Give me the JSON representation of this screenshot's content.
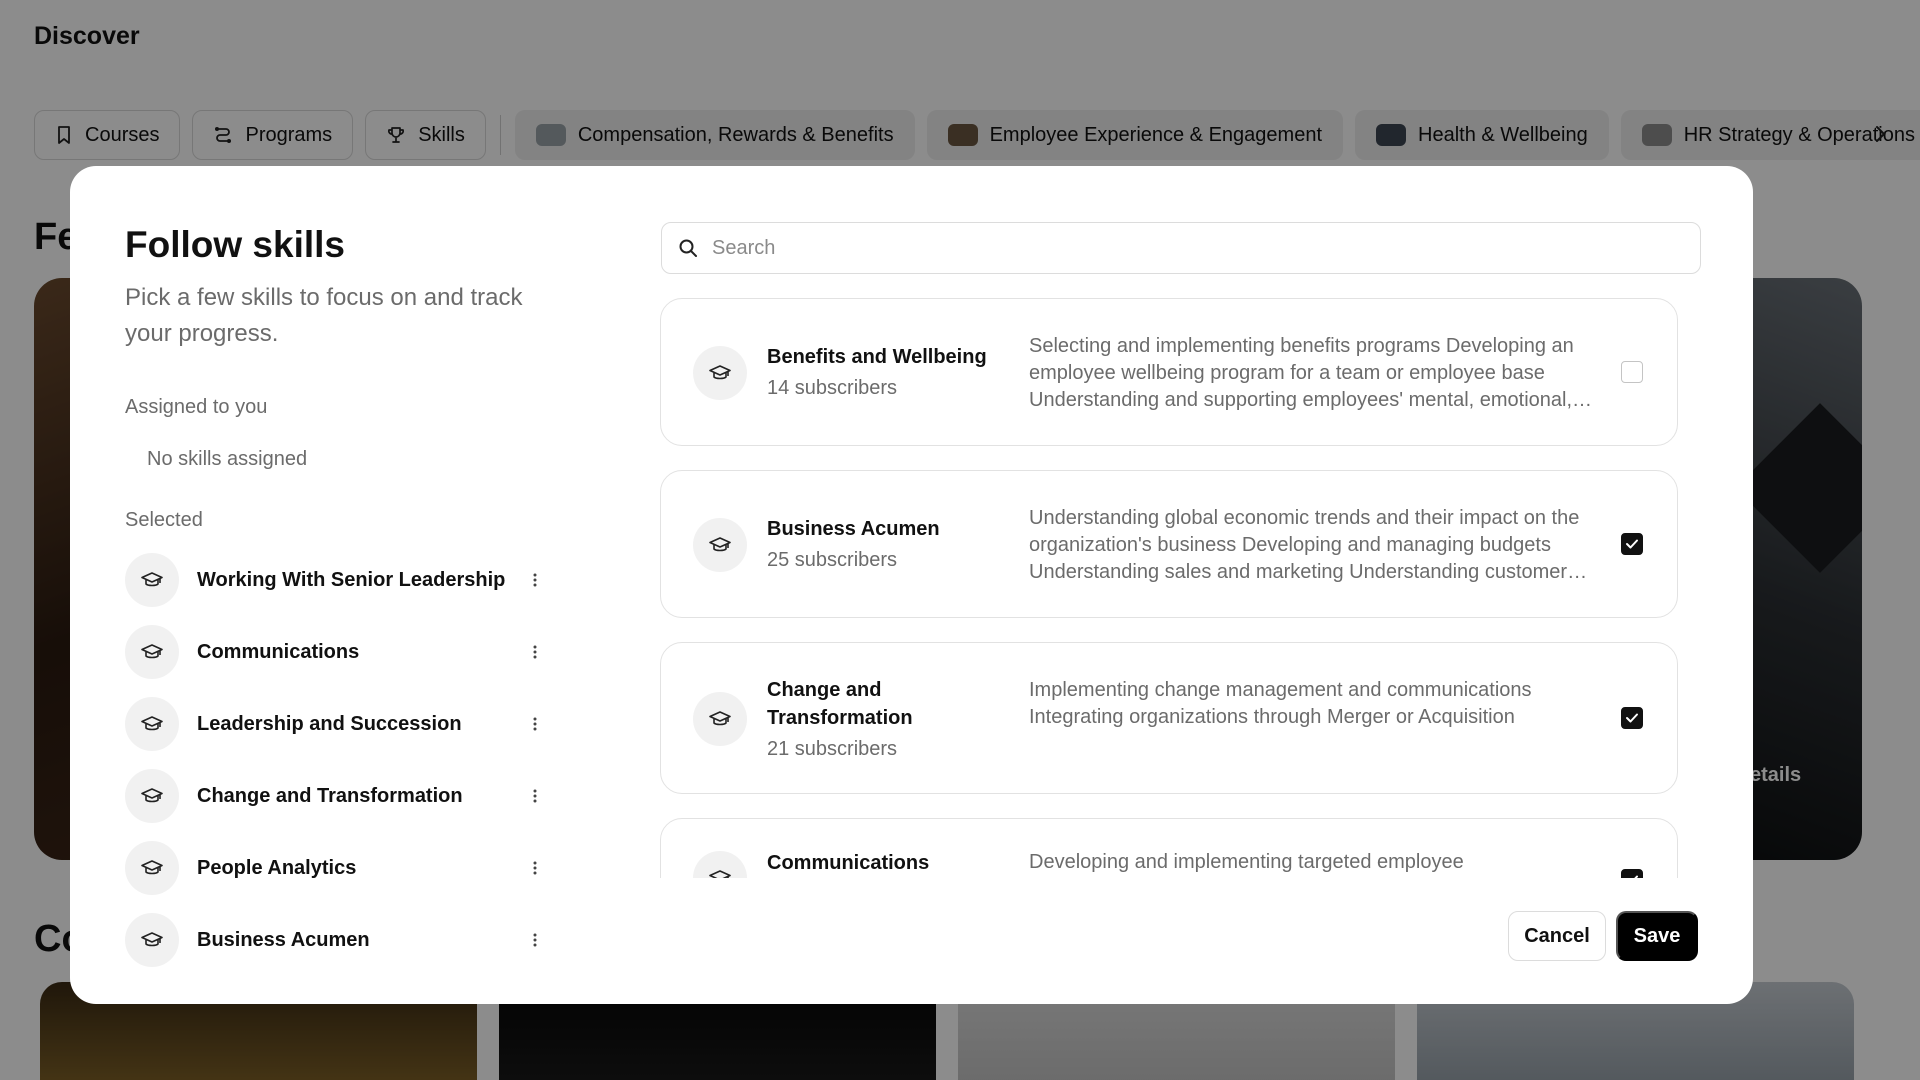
{
  "page": {
    "title": "Discover",
    "tabs": [
      {
        "label": "Courses",
        "icon": "bookmark-icon"
      },
      {
        "label": "Programs",
        "icon": "route-icon"
      },
      {
        "label": "Skills",
        "icon": "trophy-icon"
      }
    ],
    "category_tabs": [
      {
        "label": "Compensation, Rewards & Benefits",
        "thumb_color": "#9aa3a8"
      },
      {
        "label": "Employee Experience & Engagement",
        "thumb_color": "#6b5640"
      },
      {
        "label": "Health & Wellbeing",
        "thumb_color": "#3c4552"
      },
      {
        "label": "HR Strategy & Operations",
        "thumb_color": "#8c8c8c"
      }
    ],
    "heading1": "Fe",
    "heading2": "Co",
    "feature_link": "etails"
  },
  "modal": {
    "title": "Follow skills",
    "subtitle": "Pick a few skills to focus on and track your progress.",
    "assigned_label": "Assigned to you",
    "assigned_empty": "No skills assigned",
    "selected_label": "Selected",
    "selected": [
      {
        "name": "Working With Senior Leadership"
      },
      {
        "name": "Communications"
      },
      {
        "name": "Leadership and Succession"
      },
      {
        "name": "Change and Transformation"
      },
      {
        "name": "People Analytics"
      },
      {
        "name": "Business Acumen"
      }
    ],
    "search": {
      "placeholder": "Search",
      "value": ""
    },
    "skills": [
      {
        "name": "Benefits and Wellbeing",
        "subscribers": "14 subscribers",
        "description": "Selecting and implementing benefits programs Developing an employee wellbeing program for a team or employee base Understanding and supporting employees' mental, emotional, and physical health",
        "checked": false
      },
      {
        "name": "Business Acumen",
        "subscribers": "25 subscribers",
        "description": "Understanding global economic trends and their impact on the organization's business Developing and managing budgets Understanding sales and marketing Understanding customer needs",
        "checked": true
      },
      {
        "name": "Change and Transformation",
        "subscribers": "21 subscribers",
        "description": "Implementing change management and communications Integrating organizations through Merger or Acquisition",
        "checked": true
      },
      {
        "name": "Communications",
        "subscribers": "",
        "description": "Developing and implementing targeted employee communications",
        "checked": true
      }
    ],
    "cancel_label": "Cancel",
    "save_label": "Save"
  },
  "colors": {
    "accent": "#000000",
    "muted_text": "#6b6b6b",
    "overlay": "rgba(0,0,0,0.45)"
  }
}
